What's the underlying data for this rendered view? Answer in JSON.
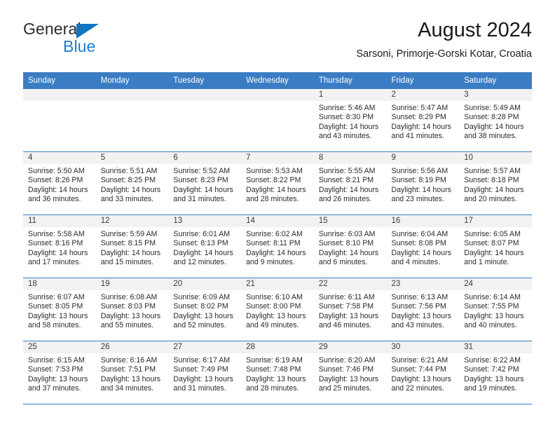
{
  "brand": {
    "name_part1": "General",
    "name_part2": "Blue",
    "triangle_color": "#1175c0",
    "blue_text_color": "#1b7fd4"
  },
  "header": {
    "title": "August 2024",
    "subtitle": "Sarsoni, Primorje-Gorski Kotar, Croatia"
  },
  "theme": {
    "header_row_bg": "#3b7dc4",
    "daynum_band_bg": "#f2f2f2",
    "grid_line": "#3b7dc4"
  },
  "weekday_headers": [
    "Sunday",
    "Monday",
    "Tuesday",
    "Wednesday",
    "Thursday",
    "Friday",
    "Saturday"
  ],
  "weeks": [
    [
      {
        "day": "",
        "empty": true,
        "sunrise": "",
        "sunset": "",
        "daylight_line1": "",
        "daylight_line2": ""
      },
      {
        "day": "",
        "empty": true,
        "sunrise": "",
        "sunset": "",
        "daylight_line1": "",
        "daylight_line2": ""
      },
      {
        "day": "",
        "empty": true,
        "sunrise": "",
        "sunset": "",
        "daylight_line1": "",
        "daylight_line2": ""
      },
      {
        "day": "",
        "empty": true,
        "sunrise": "",
        "sunset": "",
        "daylight_line1": "",
        "daylight_line2": ""
      },
      {
        "day": "1",
        "empty": false,
        "sunrise": "Sunrise: 5:46 AM",
        "sunset": "Sunset: 8:30 PM",
        "daylight_line1": "Daylight: 14 hours",
        "daylight_line2": "and 43 minutes."
      },
      {
        "day": "2",
        "empty": false,
        "sunrise": "Sunrise: 5:47 AM",
        "sunset": "Sunset: 8:29 PM",
        "daylight_line1": "Daylight: 14 hours",
        "daylight_line2": "and 41 minutes."
      },
      {
        "day": "3",
        "empty": false,
        "sunrise": "Sunrise: 5:49 AM",
        "sunset": "Sunset: 8:28 PM",
        "daylight_line1": "Daylight: 14 hours",
        "daylight_line2": "and 38 minutes."
      }
    ],
    [
      {
        "day": "4",
        "empty": false,
        "sunrise": "Sunrise: 5:50 AM",
        "sunset": "Sunset: 8:26 PM",
        "daylight_line1": "Daylight: 14 hours",
        "daylight_line2": "and 36 minutes."
      },
      {
        "day": "5",
        "empty": false,
        "sunrise": "Sunrise: 5:51 AM",
        "sunset": "Sunset: 8:25 PM",
        "daylight_line1": "Daylight: 14 hours",
        "daylight_line2": "and 33 minutes."
      },
      {
        "day": "6",
        "empty": false,
        "sunrise": "Sunrise: 5:52 AM",
        "sunset": "Sunset: 8:23 PM",
        "daylight_line1": "Daylight: 14 hours",
        "daylight_line2": "and 31 minutes."
      },
      {
        "day": "7",
        "empty": false,
        "sunrise": "Sunrise: 5:53 AM",
        "sunset": "Sunset: 8:22 PM",
        "daylight_line1": "Daylight: 14 hours",
        "daylight_line2": "and 28 minutes."
      },
      {
        "day": "8",
        "empty": false,
        "sunrise": "Sunrise: 5:55 AM",
        "sunset": "Sunset: 8:21 PM",
        "daylight_line1": "Daylight: 14 hours",
        "daylight_line2": "and 26 minutes."
      },
      {
        "day": "9",
        "empty": false,
        "sunrise": "Sunrise: 5:56 AM",
        "sunset": "Sunset: 8:19 PM",
        "daylight_line1": "Daylight: 14 hours",
        "daylight_line2": "and 23 minutes."
      },
      {
        "day": "10",
        "empty": false,
        "sunrise": "Sunrise: 5:57 AM",
        "sunset": "Sunset: 8:18 PM",
        "daylight_line1": "Daylight: 14 hours",
        "daylight_line2": "and 20 minutes."
      }
    ],
    [
      {
        "day": "11",
        "empty": false,
        "sunrise": "Sunrise: 5:58 AM",
        "sunset": "Sunset: 8:16 PM",
        "daylight_line1": "Daylight: 14 hours",
        "daylight_line2": "and 17 minutes."
      },
      {
        "day": "12",
        "empty": false,
        "sunrise": "Sunrise: 5:59 AM",
        "sunset": "Sunset: 8:15 PM",
        "daylight_line1": "Daylight: 14 hours",
        "daylight_line2": "and 15 minutes."
      },
      {
        "day": "13",
        "empty": false,
        "sunrise": "Sunrise: 6:01 AM",
        "sunset": "Sunset: 8:13 PM",
        "daylight_line1": "Daylight: 14 hours",
        "daylight_line2": "and 12 minutes."
      },
      {
        "day": "14",
        "empty": false,
        "sunrise": "Sunrise: 6:02 AM",
        "sunset": "Sunset: 8:11 PM",
        "daylight_line1": "Daylight: 14 hours",
        "daylight_line2": "and 9 minutes."
      },
      {
        "day": "15",
        "empty": false,
        "sunrise": "Sunrise: 6:03 AM",
        "sunset": "Sunset: 8:10 PM",
        "daylight_line1": "Daylight: 14 hours",
        "daylight_line2": "and 6 minutes."
      },
      {
        "day": "16",
        "empty": false,
        "sunrise": "Sunrise: 6:04 AM",
        "sunset": "Sunset: 8:08 PM",
        "daylight_line1": "Daylight: 14 hours",
        "daylight_line2": "and 4 minutes."
      },
      {
        "day": "17",
        "empty": false,
        "sunrise": "Sunrise: 6:05 AM",
        "sunset": "Sunset: 8:07 PM",
        "daylight_line1": "Daylight: 14 hours",
        "daylight_line2": "and 1 minute."
      }
    ],
    [
      {
        "day": "18",
        "empty": false,
        "sunrise": "Sunrise: 6:07 AM",
        "sunset": "Sunset: 8:05 PM",
        "daylight_line1": "Daylight: 13 hours",
        "daylight_line2": "and 58 minutes."
      },
      {
        "day": "19",
        "empty": false,
        "sunrise": "Sunrise: 6:08 AM",
        "sunset": "Sunset: 8:03 PM",
        "daylight_line1": "Daylight: 13 hours",
        "daylight_line2": "and 55 minutes."
      },
      {
        "day": "20",
        "empty": false,
        "sunrise": "Sunrise: 6:09 AM",
        "sunset": "Sunset: 8:02 PM",
        "daylight_line1": "Daylight: 13 hours",
        "daylight_line2": "and 52 minutes."
      },
      {
        "day": "21",
        "empty": false,
        "sunrise": "Sunrise: 6:10 AM",
        "sunset": "Sunset: 8:00 PM",
        "daylight_line1": "Daylight: 13 hours",
        "daylight_line2": "and 49 minutes."
      },
      {
        "day": "22",
        "empty": false,
        "sunrise": "Sunrise: 6:11 AM",
        "sunset": "Sunset: 7:58 PM",
        "daylight_line1": "Daylight: 13 hours",
        "daylight_line2": "and 46 minutes."
      },
      {
        "day": "23",
        "empty": false,
        "sunrise": "Sunrise: 6:13 AM",
        "sunset": "Sunset: 7:56 PM",
        "daylight_line1": "Daylight: 13 hours",
        "daylight_line2": "and 43 minutes."
      },
      {
        "day": "24",
        "empty": false,
        "sunrise": "Sunrise: 6:14 AM",
        "sunset": "Sunset: 7:55 PM",
        "daylight_line1": "Daylight: 13 hours",
        "daylight_line2": "and 40 minutes."
      }
    ],
    [
      {
        "day": "25",
        "empty": false,
        "sunrise": "Sunrise: 6:15 AM",
        "sunset": "Sunset: 7:53 PM",
        "daylight_line1": "Daylight: 13 hours",
        "daylight_line2": "and 37 minutes."
      },
      {
        "day": "26",
        "empty": false,
        "sunrise": "Sunrise: 6:16 AM",
        "sunset": "Sunset: 7:51 PM",
        "daylight_line1": "Daylight: 13 hours",
        "daylight_line2": "and 34 minutes."
      },
      {
        "day": "27",
        "empty": false,
        "sunrise": "Sunrise: 6:17 AM",
        "sunset": "Sunset: 7:49 PM",
        "daylight_line1": "Daylight: 13 hours",
        "daylight_line2": "and 31 minutes."
      },
      {
        "day": "28",
        "empty": false,
        "sunrise": "Sunrise: 6:19 AM",
        "sunset": "Sunset: 7:48 PM",
        "daylight_line1": "Daylight: 13 hours",
        "daylight_line2": "and 28 minutes."
      },
      {
        "day": "29",
        "empty": false,
        "sunrise": "Sunrise: 6:20 AM",
        "sunset": "Sunset: 7:46 PM",
        "daylight_line1": "Daylight: 13 hours",
        "daylight_line2": "and 25 minutes."
      },
      {
        "day": "30",
        "empty": false,
        "sunrise": "Sunrise: 6:21 AM",
        "sunset": "Sunset: 7:44 PM",
        "daylight_line1": "Daylight: 13 hours",
        "daylight_line2": "and 22 minutes."
      },
      {
        "day": "31",
        "empty": false,
        "sunrise": "Sunrise: 6:22 AM",
        "sunset": "Sunset: 7:42 PM",
        "daylight_line1": "Daylight: 13 hours",
        "daylight_line2": "and 19 minutes."
      }
    ]
  ]
}
